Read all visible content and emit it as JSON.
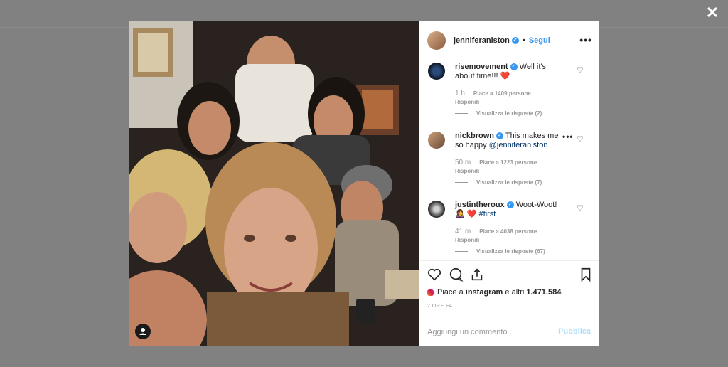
{
  "overlay": {
    "close_icon": "close-icon"
  },
  "post": {
    "author": "jenniferaniston",
    "follow_separator": "•",
    "follow_label": "Segui",
    "more_icon": "more-options-icon",
    "tag_icon": "user-tag-icon"
  },
  "comments": [
    {
      "user": "risemovement",
      "text": "Well it's about time!!!",
      "emoji": "❤️",
      "time": "1 h",
      "likes": "Piace a 1409 persone",
      "reply": "Rispondi",
      "view_replies": "Visualizza le risposte (2)"
    },
    {
      "user": "nickbrown",
      "text": "This makes me so happy",
      "mention": "@jenniferaniston",
      "time": "50 m",
      "likes": "Piace a 1223 persone",
      "reply": "Rispondi",
      "view_replies": "Visualizza le risposte (7)"
    },
    {
      "user": "justintheroux",
      "text": "Woot-Woot!",
      "emoji": "👩‍🎤",
      "heart": "❤️",
      "hashtag": "#first",
      "time": "41 m",
      "likes": "Piace a 4038 persone",
      "reply": "Rispondi",
      "view_replies": "Visualizza le risposte (67)"
    }
  ],
  "actions": {
    "like_icon": "heart-icon",
    "comment_icon": "comment-icon",
    "share_icon": "share-icon",
    "save_icon": "bookmark-icon",
    "likes_prefix": "Piace a",
    "likes_user": "instagram",
    "likes_and": "e altri",
    "likes_count": "1.471.584",
    "time_ago": "2 ORE FA"
  },
  "comment_box": {
    "placeholder": "Aggiungi un commento...",
    "post_label": "Pubblica"
  }
}
